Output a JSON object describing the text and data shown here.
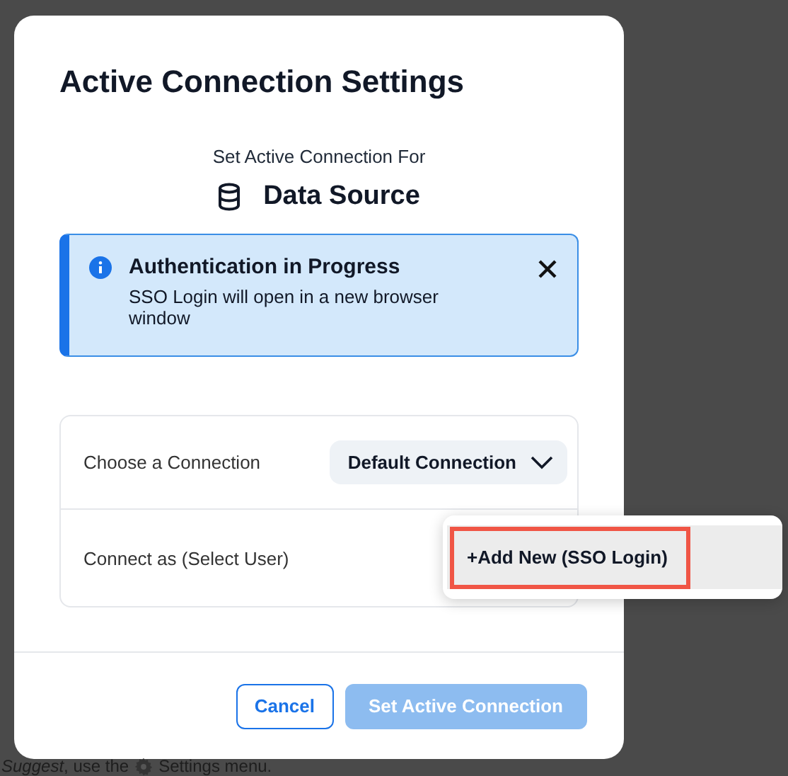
{
  "background": {
    "hint_text": "*Suggest*, use the",
    "hint_tail": "Settings menu."
  },
  "dialog": {
    "title": "Active Connection Settings",
    "subtitle": "Set Active Connection For",
    "target": "Data Source",
    "alert": {
      "title": "Authentication in Progress",
      "message": "SSO Login will open in a new browser window",
      "dismissible": true
    },
    "fields": [
      {
        "label": "Choose a Connection",
        "kind": "select",
        "value": "Default Connection"
      },
      {
        "label": "Connect as (Select User)",
        "kind": "menu"
      }
    ],
    "buttons": [
      {
        "label": "Cancel",
        "kind": "secondary",
        "disabled": false
      },
      {
        "label": "Set Active Connection",
        "kind": "primary",
        "disabled": true
      }
    ]
  },
  "user_menu": {
    "items": [
      {
        "label": "+Add New (SSO Login)",
        "highlighted": true,
        "outlined": true
      }
    ]
  }
}
